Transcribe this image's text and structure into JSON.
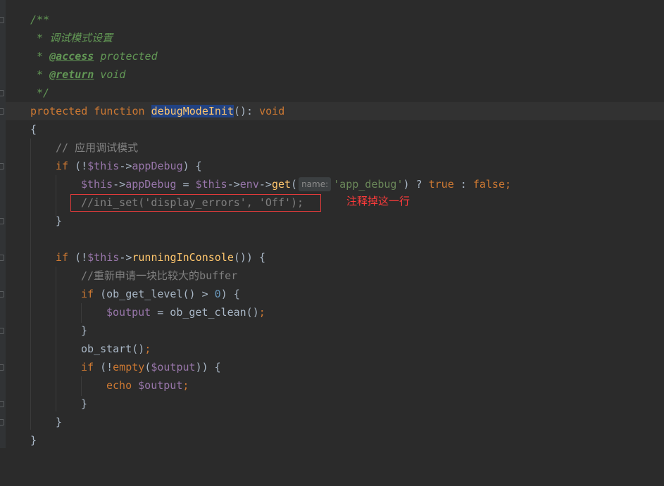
{
  "editor": {
    "lines": {
      "l1": "/**",
      "l2": " * 调试模式设置",
      "l3_star": " * ",
      "l3_tag": "@access",
      "l3_rest": " protected",
      "l4_star": " * ",
      "l4_tag": "@return",
      "l4_rest": " void",
      "l5": " */",
      "l6_kw1": "protected",
      "l6_kw2": "function",
      "l6_name": "debugModeInit",
      "l6_paren": "():",
      "l6_ret": "void",
      "l7": "{",
      "l8": "// 应用调试模式",
      "l9_if": "if",
      "l9_open": " (!",
      "l9_this": "$this",
      "l9_arrow": "->",
      "l9_prop": "appDebug",
      "l9_close": ") {",
      "l10_this": "$this",
      "l10_arrow1": "->",
      "l10_prop": "appDebug",
      "l10_eq": " = ",
      "l10_this2": "$this",
      "l10_arrow2": "->",
      "l10_env": "env",
      "l10_arrow3": "->",
      "l10_get": "get",
      "l10_paren": "(",
      "l10_hint": "name:",
      "l10_str": "'app_debug'",
      "l10_tern": ") ? ",
      "l10_true": "true",
      "l10_colon": " : ",
      "l10_false": "false",
      "l10_semi": ";",
      "l11": "//ini_set('display_errors', 'Off');",
      "l12": "}",
      "l14_if": "if",
      "l14_open": " (!",
      "l14_this": "$this",
      "l14_arrow": "->",
      "l14_fn": "runningInConsole",
      "l14_close": "()) {",
      "l15": "//重新申请一块比较大的buffer",
      "l16_if": "if",
      "l16_a": " (ob_get_level() > ",
      "l16_num": "0",
      "l16_b": ") {",
      "l17_var": "$output",
      "l17_eq": " = ob_get_clean()",
      "l17_semi": ";",
      "l18": "}",
      "l19_fn": "ob_start()",
      "l19_semi": ";",
      "l20_if": "if",
      "l20_open": " (!",
      "l20_empty": "empty",
      "l20_paren": "(",
      "l20_var": "$output",
      "l20_close": ")) {",
      "l21_echo": "echo",
      "l21_sp": " ",
      "l21_var": "$output",
      "l21_semi": ";",
      "l22": "}",
      "l23": "}",
      "l24": "}"
    }
  },
  "annotation": {
    "text": "注释掉这一行"
  },
  "colors": {
    "background": "#2b2b2b",
    "annotation": "#ff3b3b",
    "box_border": "#e03a3a"
  }
}
